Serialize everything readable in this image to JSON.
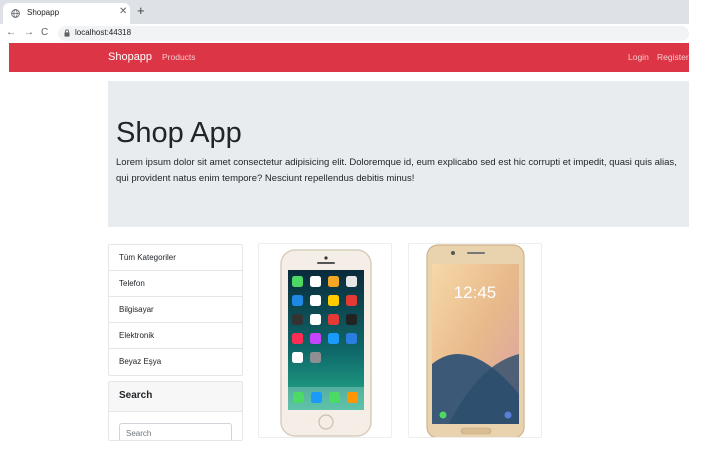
{
  "browser": {
    "tab_title": "Shopapp",
    "tab_close": "✕",
    "new_tab": "+",
    "back": "←",
    "forward": "→",
    "reload": "C",
    "url": "localhost:44318"
  },
  "navbar": {
    "brand": "Shopapp",
    "products": "Products",
    "login": "Login",
    "register": "Register",
    "color": "#dc3545"
  },
  "jumbotron": {
    "title": "Shop App",
    "text": "Lorem ipsum dolor sit amet consectetur adipisicing elit. Doloremque id, eum explicabo sed est hic corrupti et impedit, quasi quis alias, qui provident natus enim tempore? Nesciunt repellendus debitis minus!"
  },
  "categories": [
    "Tüm Kategoriler",
    "Telefon",
    "Bilgisayar",
    "Elektronik",
    "Beyaz Eşya"
  ],
  "search": {
    "header": "Search",
    "placeholder": "Search"
  },
  "products": [
    {
      "image": "iphone-icon",
      "screen_time": ""
    },
    {
      "image": "samsung-phone-icon",
      "screen_time": "12:45"
    }
  ]
}
